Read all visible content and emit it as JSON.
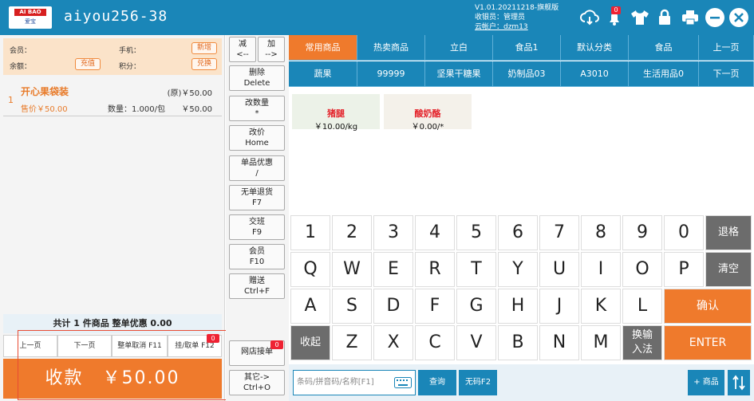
{
  "header": {
    "logo_top": "AI BAO",
    "logo_bottom": "爱宝",
    "store_name": "aiyou256-38",
    "version": "V1.01.20211218-旗舰版",
    "cashier": "收银员：管理员",
    "cloud_account": "云帐户：dzm13",
    "bell_count": "0"
  },
  "member": {
    "member_label": "会员：",
    "phone_label": "手机：",
    "balance_label": "余额：",
    "points_label": "积分：",
    "add_button": "新增",
    "recharge_button": "充值",
    "exchange_button": "兑换"
  },
  "cart": {
    "index": "1",
    "name": "开心果袋装",
    "original_price": "(原)￥50.00",
    "sale_price": "售价￥50.00",
    "quantity": "数量：1.000/包",
    "subtotal": "￥50.00"
  },
  "summary": "共计 1 件商品 整单优惠 0.00",
  "left_buttons": {
    "prev_page": "上一页",
    "next_page": "下一页",
    "cancel_order": "整单取消 F11",
    "hold_order": "挂/取单 F12",
    "hold_badge": "0"
  },
  "pay": {
    "label": "收款　￥50.00"
  },
  "functions": {
    "minus": [
      "减",
      "<--"
    ],
    "plus": [
      "加",
      "-->"
    ],
    "delete": [
      "删除",
      "Delete"
    ],
    "change_qty": [
      "改数量",
      "*"
    ],
    "change_price": [
      "改价",
      "Home"
    ],
    "item_discount": [
      "单品优惠",
      "/"
    ],
    "no_receipt_return": [
      "无单退货",
      "F7"
    ],
    "handover": [
      "交班",
      "F9"
    ],
    "member": [
      "会员",
      "F10"
    ],
    "gift": [
      "赠送",
      "Ctrl+F"
    ],
    "online_orders": "网店接单",
    "online_badge": "0",
    "other": [
      "其它->",
      "Ctrl+O"
    ]
  },
  "categories_row1": [
    "常用商品",
    "热卖商品",
    "立白",
    "食品1",
    "默认分类",
    "食品",
    "上一页"
  ],
  "categories_row2": [
    "蔬果",
    "99999",
    "坚果干糖果",
    "奶制品03",
    "A3010",
    "生活用品0",
    "下一页"
  ],
  "products": [
    {
      "name": "猪腿",
      "price": "￥10.00/kg"
    },
    {
      "name": "酸奶酪",
      "price": "￥0.00/*"
    }
  ],
  "keyboard": {
    "digits": [
      "1",
      "2",
      "3",
      "4",
      "5",
      "6",
      "7",
      "8",
      "9",
      "0"
    ],
    "backspace": "退格",
    "row_q": [
      "Q",
      "W",
      "E",
      "R",
      "T",
      "Y",
      "U",
      "I",
      "O",
      "P"
    ],
    "clear": "清空",
    "row_a": [
      "A",
      "S",
      "D",
      "F",
      "G",
      "H",
      "J",
      "K",
      "L"
    ],
    "confirm": "确认",
    "collapse": "收起",
    "row_z": [
      "Z",
      "X",
      "C",
      "V",
      "B",
      "N",
      "M"
    ],
    "switch_ime": [
      "换输",
      "入法"
    ],
    "enter": "ENTER"
  },
  "bottom": {
    "search_placeholder": "条码/拼音码/名称[F1]",
    "query": "查询",
    "no_barcode": "无码F2",
    "add_product": "+ 商品"
  },
  "colors": {
    "primary": "#1a86b8",
    "accent": "#ef7a2c",
    "danger": "#e4222a"
  }
}
